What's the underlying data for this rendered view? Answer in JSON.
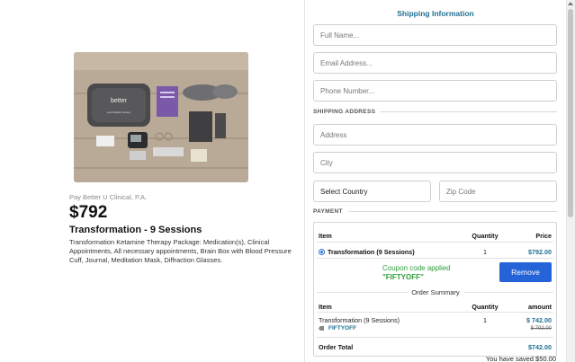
{
  "product": {
    "merchant": "Pay Better U Clinical, P.A.",
    "price": "$792",
    "title": "Transformation - 9 Sessions",
    "description": "Transformation Ketamine Therapy Package: Medication(s), Clinical Appointments, All necessary appointments, Brain Box with Blood Pressure Cuff, Journal, Meditation Mask, Diffraction Glasses.",
    "image_label_1": "better",
    "image_label_2": "psychedelic therapy"
  },
  "checkout": {
    "heading": "Shipping Information",
    "full_name_placeholder": "Full Name...",
    "email_placeholder": "Email Address...",
    "phone_placeholder": "Phone Number...",
    "shipping_label": "SHIPPING ADDRESS",
    "address_placeholder": "Address",
    "city_placeholder": "City",
    "country_selected": "Select Country",
    "zip_placeholder": "Zip Code",
    "payment_label": "PAYMENT"
  },
  "payment_table": {
    "headers": [
      "Item",
      "Quantity",
      "Price"
    ],
    "item": "Transformation (9 Sessions)",
    "quantity": "1",
    "price": "$792.00"
  },
  "coupon": {
    "message": "Coupon code applied",
    "code": "\"FIFTYOFF\"",
    "remove_label": "Remove"
  },
  "summary": {
    "title": "Order Summary",
    "headers": [
      "Item",
      "Quantity",
      "amount"
    ],
    "item": "Transformation (9 Sessions)",
    "quantity": "1",
    "amount": "$ 742.00",
    "original_amount": "$ 792.00",
    "coupon_tag": "FIFTYOFF",
    "total_label": "Order Total",
    "total_value": "$742.00",
    "saved_text": "You have saved $50.00"
  },
  "colors": {
    "accent_blue": "#1f6f93",
    "button_blue": "#2563d8",
    "success_green": "#2e9d3c"
  }
}
